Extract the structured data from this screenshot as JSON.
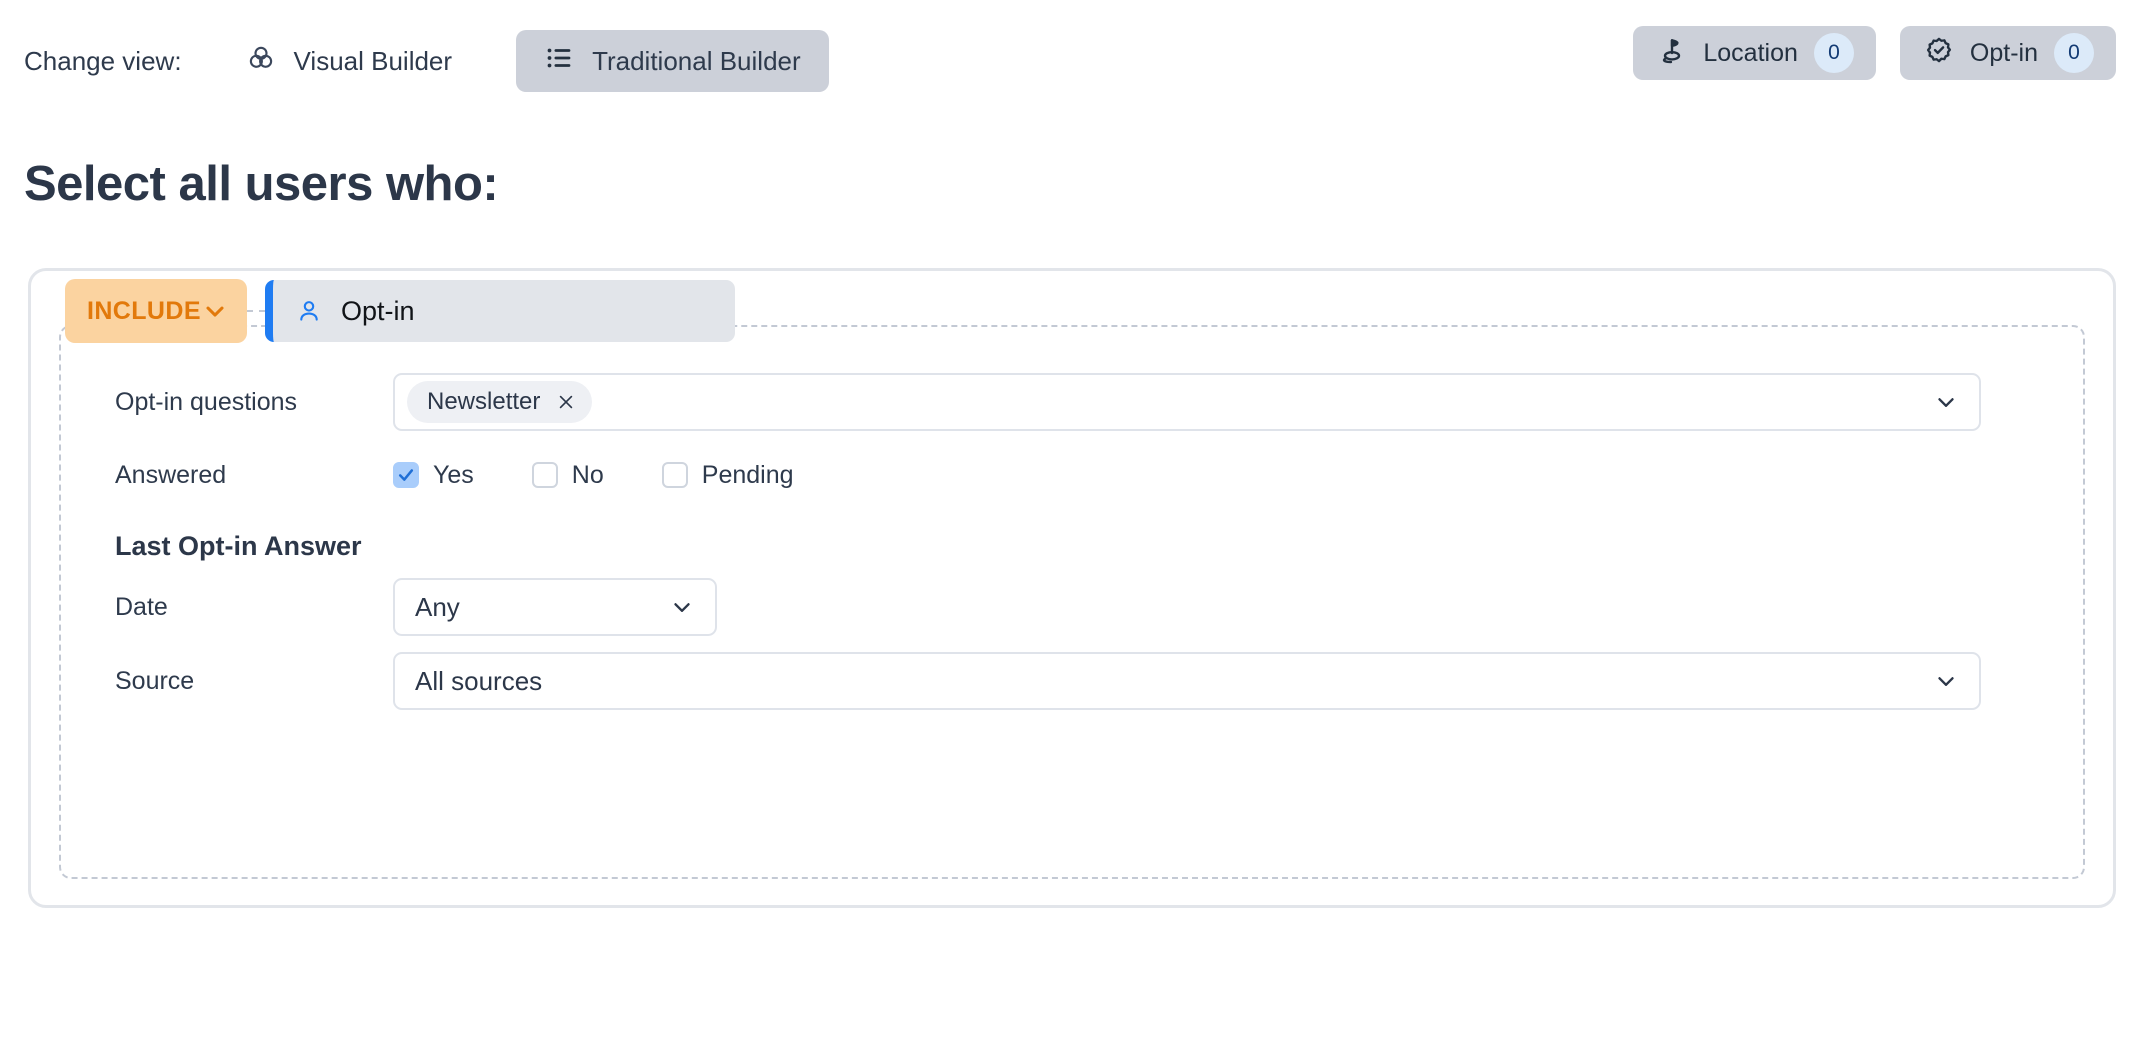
{
  "topbar": {
    "change_view_label": "Change view:",
    "views": [
      {
        "label": "Visual Builder",
        "icon": "venn-circles-icon",
        "active": false
      },
      {
        "label": "Traditional Builder",
        "icon": "bulleted-list-icon",
        "active": true
      }
    ],
    "tabs": [
      {
        "label": "Location",
        "count": "0",
        "icon": "location-pin-flag-icon"
      },
      {
        "label": "Opt-in",
        "count": "0",
        "icon": "badge-check-icon"
      }
    ]
  },
  "page": {
    "title": "Select all users who:"
  },
  "rule": {
    "include_label": "INCLUDE",
    "node_label": "Opt-in",
    "node_icon": "person-icon",
    "accent_color": "#1f7cf2",
    "include_bg": "#fbd3a0",
    "include_text_color": "#e2790b",
    "fields": {
      "questions_label": "Opt-in questions",
      "questions_tags": [
        "Newsletter"
      ],
      "answered_label": "Answered",
      "answered_options": [
        {
          "label": "Yes",
          "checked": true
        },
        {
          "label": "No",
          "checked": false
        },
        {
          "label": "Pending",
          "checked": false
        }
      ],
      "last_answer_heading": "Last Opt-in Answer",
      "date_label": "Date",
      "date_value": "Any",
      "source_label": "Source",
      "source_value": "All sources"
    }
  }
}
